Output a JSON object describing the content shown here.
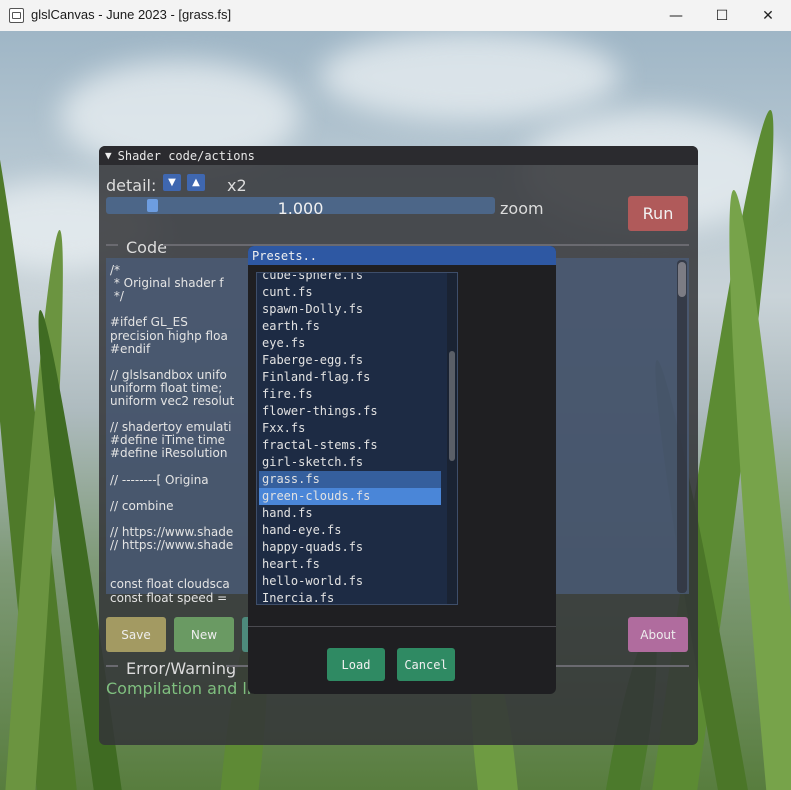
{
  "window": {
    "title": "glslCanvas - June 2023 - [grass.fs]",
    "minimize": "—",
    "maximize": "☐",
    "close": "✕"
  },
  "panel": {
    "header": "Shader code/actions",
    "detail_label": "detail:",
    "detail_down": "▼",
    "detail_up": "▲",
    "detail_value": "x2",
    "zoom": {
      "value": "1.000",
      "label": "zoom",
      "fraction": 0.11
    },
    "run": "Run",
    "code_section": "Code",
    "code_lines": [
      "/*",
      " * Original shader f",
      " */",
      "",
      "#ifdef GL_ES",
      "precision highp floa",
      "#endif",
      "",
      "// glslsandbox unifo",
      "uniform float time;",
      "uniform vec2 resolut",
      "",
      "// shadertoy emulati",
      "#define iTime time",
      "#define iResolution",
      "",
      "// --------[ Origina",
      "",
      "// combine",
      "",
      "// https://www.shade",
      "// https://www.shade",
      "",
      "",
      "const float cloudsca",
      "const float speed ="
    ],
    "buttons": {
      "save": "Save",
      "new": "New",
      "about": "About"
    },
    "error_section": "Error/Warning",
    "status": "Compilation and link"
  },
  "presets": {
    "title": "Presets..",
    "items": [
      "cube-sphere.fs",
      "cunt.fs",
      "spawn-Dolly.fs",
      "earth.fs",
      "eye.fs",
      "Faberge-egg.fs",
      "Finland-flag.fs",
      "fire.fs",
      "flower-things.fs",
      "Fxx.fs",
      "fractal-stems.fs",
      "girl-sketch.fs",
      "grass.fs",
      "green-clouds.fs",
      "hand.fs",
      "hand-eye.fs",
      "happy-quads.fs",
      "heart.fs",
      "hello-world.fs",
      "Inercia.fs"
    ],
    "selected": "grass.fs",
    "hovered": "green-clouds.fs",
    "load": "Load",
    "cancel": "Cancel"
  },
  "colors": {
    "accent": "#3f67b0",
    "run": "#b05a5a",
    "save": "#a39a62",
    "new": "#6a9a63",
    "about": "#b06c9e",
    "dialog_button": "#2f8a63"
  }
}
